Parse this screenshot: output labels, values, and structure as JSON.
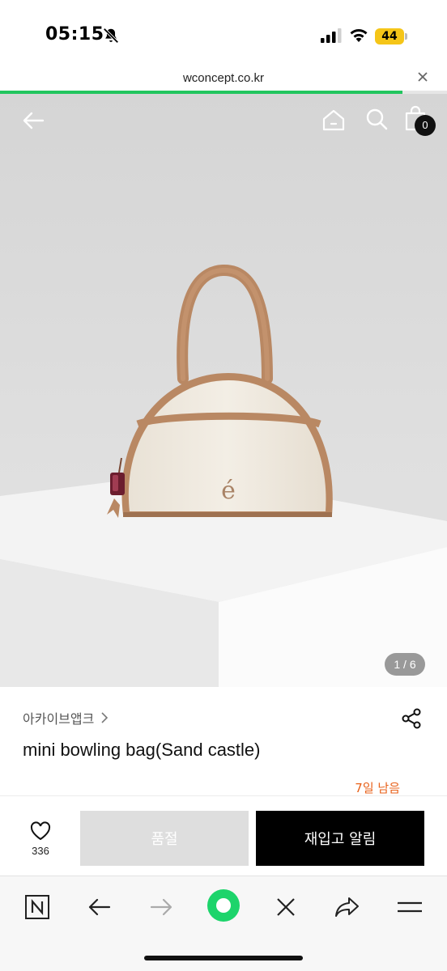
{
  "status_bar": {
    "time": "05:15",
    "battery": "44",
    "icons": [
      "bell-slash-icon",
      "signal-icon",
      "wifi-icon",
      "battery-icon"
    ]
  },
  "browser": {
    "url": "wconcept.co.kr",
    "load_progress": 0.9,
    "accent": "#22c55e"
  },
  "header": {
    "cart_count": "0",
    "icons": [
      "back-arrow-icon",
      "home-icon",
      "search-icon",
      "shopping-bag-icon"
    ]
  },
  "gallery": {
    "page_indicator": "1 / 6",
    "monogram": "é"
  },
  "product": {
    "brand": "아카이브앱크",
    "title": "mini bowling bag(Sand castle)",
    "remaining": "7일 남음",
    "remaining_color": "#e8611a"
  },
  "actions": {
    "like_count": "336",
    "soldout_label": "품절",
    "notify_label": "재입고 알림"
  },
  "toolbar": {
    "icons": [
      "naver-n-icon",
      "back-icon",
      "forward-icon",
      "green-circle-icon",
      "close-icon",
      "share-arrow-icon",
      "menu-icon"
    ]
  }
}
